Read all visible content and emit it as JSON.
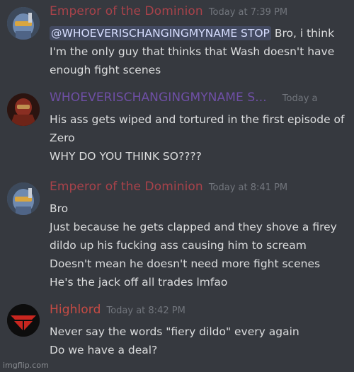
{
  "messages": [
    {
      "username": "Emperor of the Dominion",
      "username_color": "#a8424a",
      "avatar_icon": "spartan-helmet-blue-icon",
      "timestamp": "Today at 7:39 PM",
      "mention": "@WHOEVERISCHANGINGMYNAME STOP",
      "lines": [
        " Bro, i think",
        "I'm the only guy that thinks that Wash doesn't have",
        "enough fight scenes"
      ]
    },
    {
      "username": "WHOEVERISCHANGINGMYNAME S...",
      "username_color": "#6f4fa6",
      "avatar_icon": "spartan-armor-red-icon",
      "timestamp": "Today a",
      "lines": [
        "His ass gets wiped and tortured in the first episode of",
        "Zero",
        "WHY DO YOU THINK SO????"
      ]
    },
    {
      "username": "Emperor of the Dominion",
      "username_color": "#a8424a",
      "avatar_icon": "spartan-helmet-blue-icon",
      "timestamp": "Today at 8:41 PM",
      "lines": [
        "Bro",
        "Just because he gets clapped and they shove a firey",
        "dildo up his fucking ass causing him to scream",
        "Doesn't mean he doesn't need more fight scenes",
        "He's the jack off all trades lmfao"
      ]
    },
    {
      "username": "Highlord",
      "username_color": "#c64b44",
      "avatar_icon": "red-emblem-icon",
      "timestamp": "Today at 8:42 PM",
      "lines": [
        "Never say the words \"fiery dildo\" every again",
        "Do we have a deal?"
      ]
    }
  ],
  "watermark": "imgflip.com"
}
